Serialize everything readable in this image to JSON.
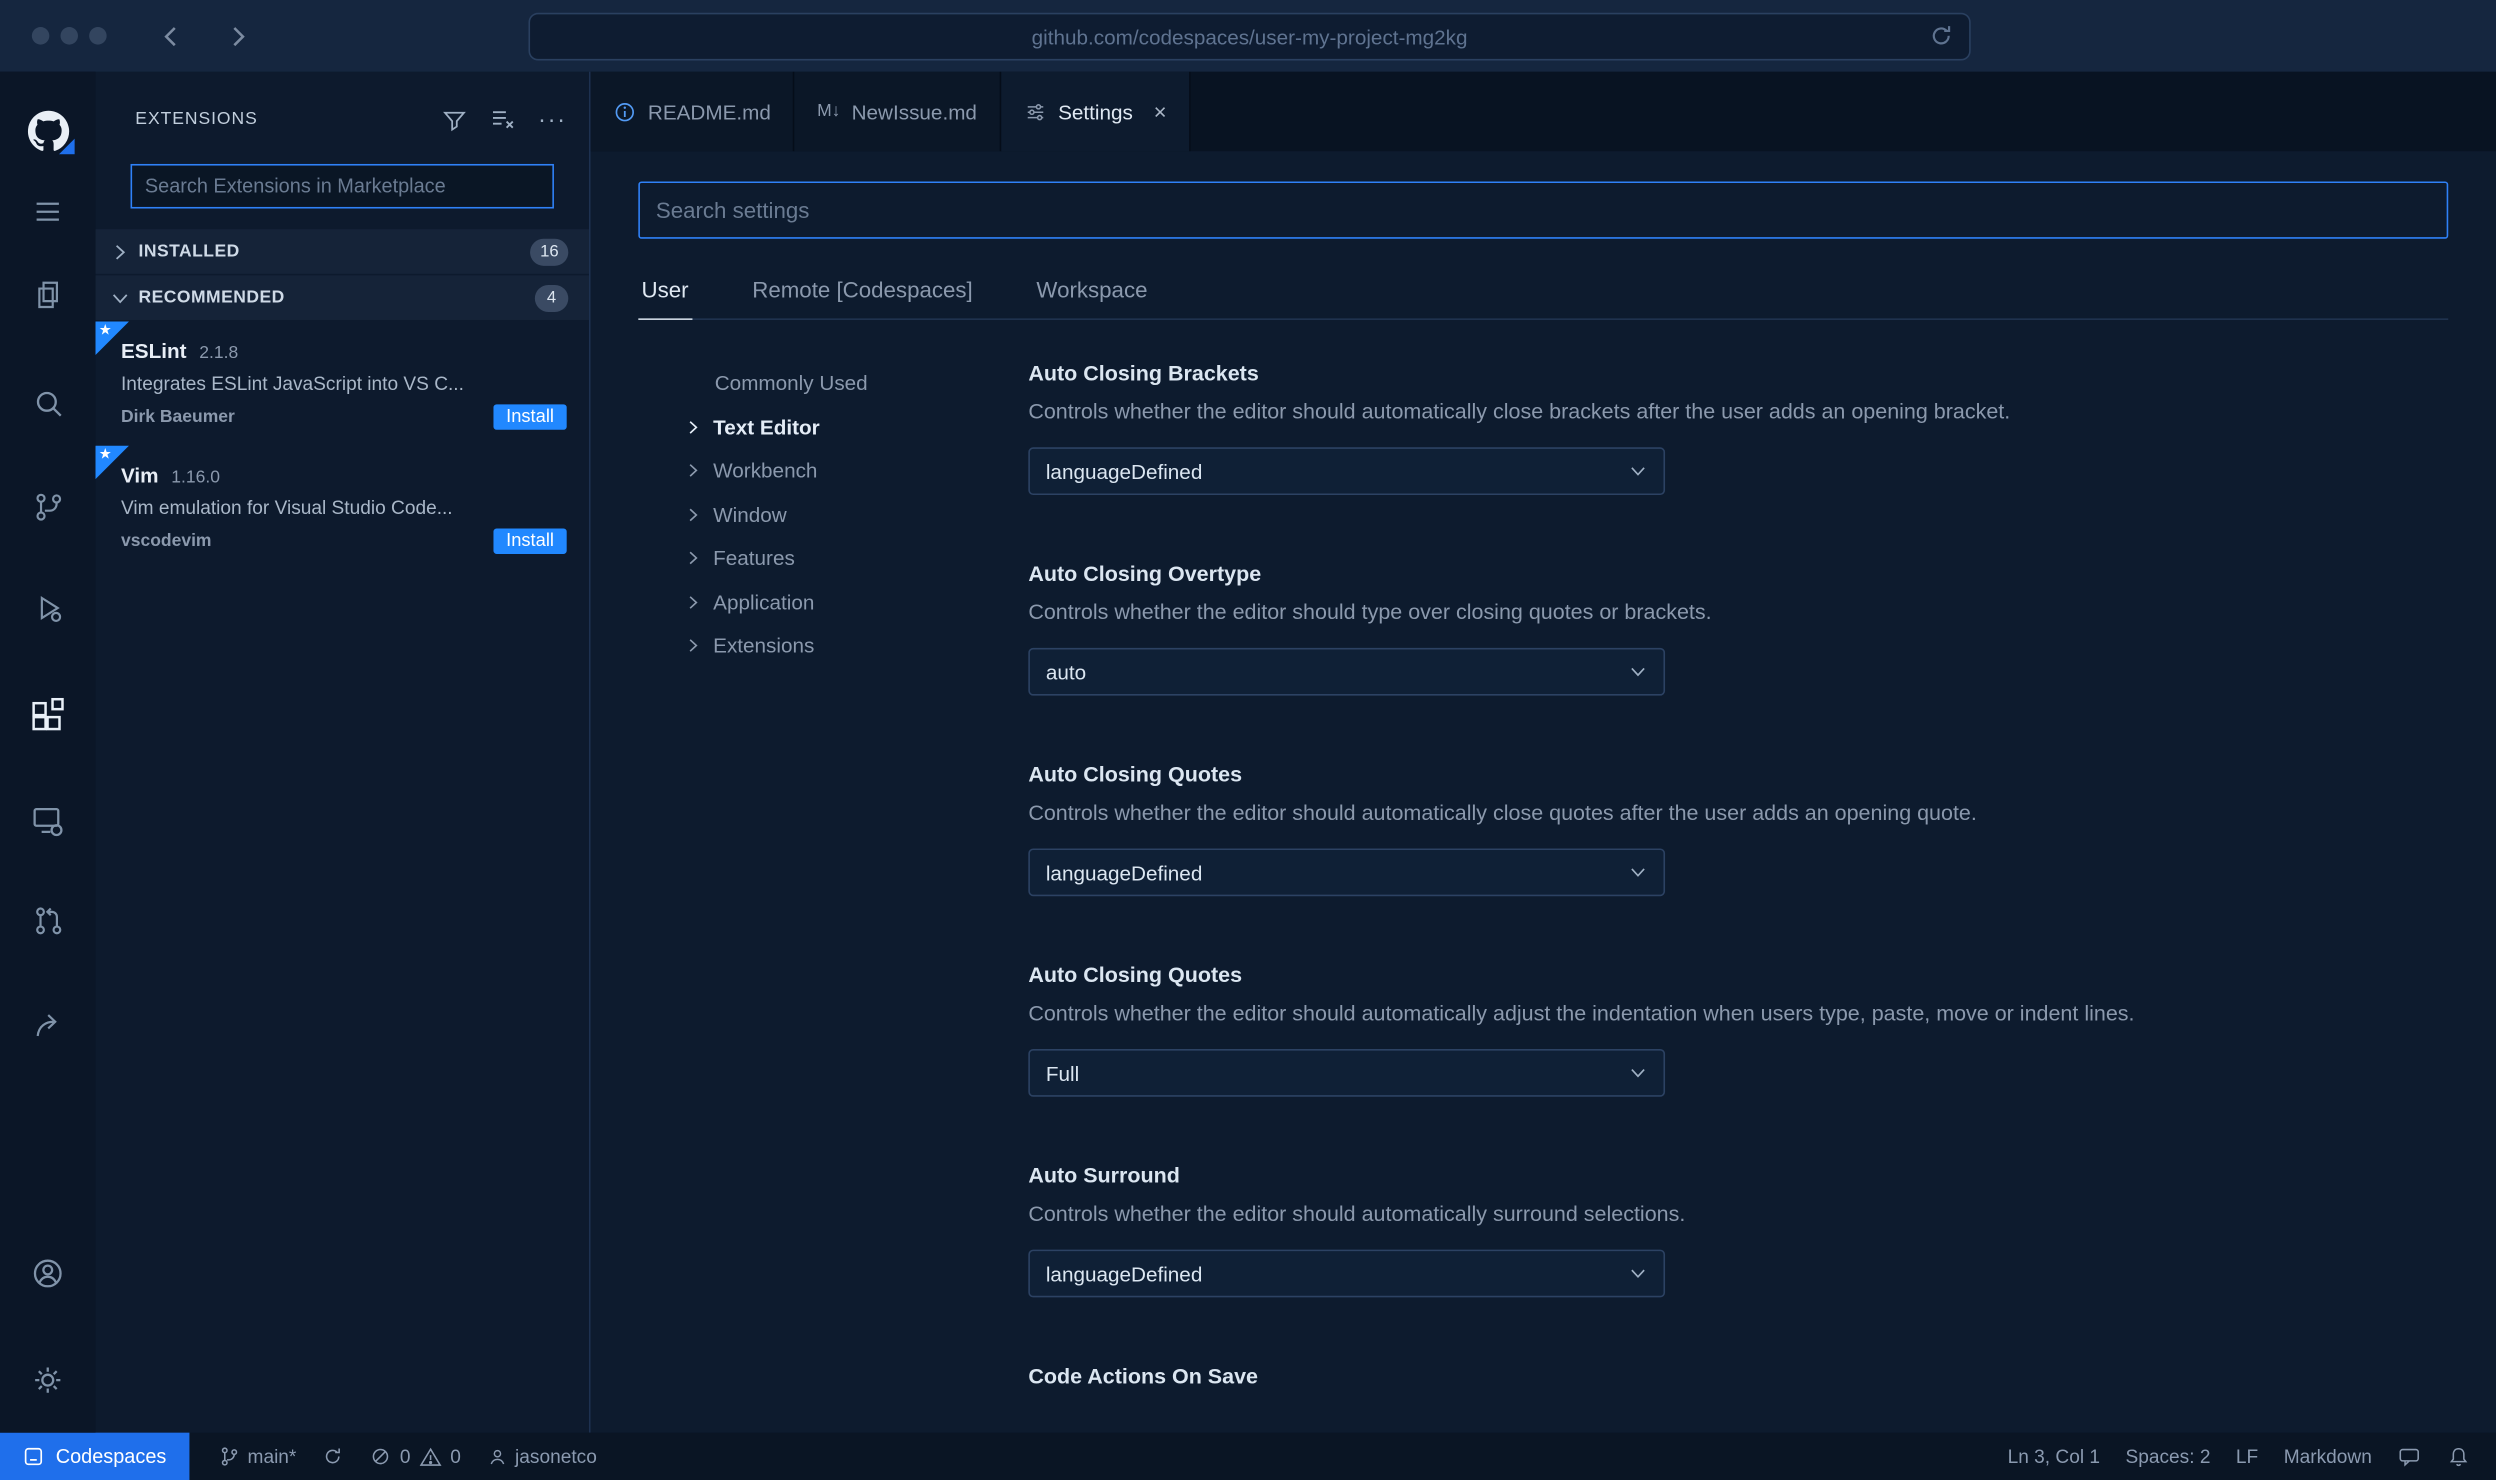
{
  "browser": {
    "url": "github.com/codespaces/user-my-project-mg2kg"
  },
  "icons": {
    "more_actions": "···",
    "close": "×",
    "star": "★",
    "markdown_badge": "M↓"
  },
  "sidebar": {
    "title": "EXTENSIONS",
    "search_placeholder": "Search Extensions in Marketplace",
    "sections": [
      {
        "label": "INSTALLED",
        "count": "16"
      },
      {
        "label": "RECOMMENDED",
        "count": "4"
      }
    ],
    "extensions": [
      {
        "name": "ESLint",
        "version": "2.1.8",
        "description": "Integrates ESLint JavaScript into VS C...",
        "author": "Dirk Baeumer",
        "action": "Install"
      },
      {
        "name": "Vim",
        "version": "1.16.0",
        "description": "Vim emulation for Visual Studio Code...",
        "author": "vscodevim",
        "action": "Install"
      }
    ]
  },
  "tabs": [
    {
      "label": "README.md"
    },
    {
      "label": "NewIssue.md"
    },
    {
      "label": "Settings"
    }
  ],
  "settings": {
    "search_placeholder": "Search settings",
    "scopes": [
      "User",
      "Remote [Codespaces]",
      "Workspace"
    ],
    "toc": [
      "Commonly Used",
      "Text Editor",
      "Workbench",
      "Window",
      "Features",
      "Application",
      "Extensions"
    ],
    "items": [
      {
        "title": "Auto Closing Brackets",
        "description": "Controls whether the editor should automatically close brackets after the user adds an opening bracket.",
        "value": "languageDefined"
      },
      {
        "title": "Auto Closing Overtype",
        "description": "Controls whether the editor should type over closing quotes or brackets.",
        "value": "auto"
      },
      {
        "title": "Auto Closing Quotes",
        "description": "Controls whether the editor should automatically close quotes after the user adds an opening quote.",
        "value": "languageDefined"
      },
      {
        "title": "Auto Closing Quotes",
        "description": "Controls whether the editor should automatically adjust the indentation when users type, paste, move or indent lines.",
        "value": "Full"
      },
      {
        "title": "Auto Surround",
        "description": "Controls whether the editor should automatically surround selections.",
        "value": "languageDefined"
      },
      {
        "title": "Code Actions On Save",
        "description": "",
        "value": ""
      }
    ]
  },
  "status_bar": {
    "codespaces": "Codespaces",
    "branch": "main*",
    "errors": "0",
    "warnings": "0",
    "user": "jasonetco",
    "line_col": "Ln 3, Col 1",
    "spaces": "Spaces: 2",
    "eol": "LF",
    "language": "Markdown"
  }
}
